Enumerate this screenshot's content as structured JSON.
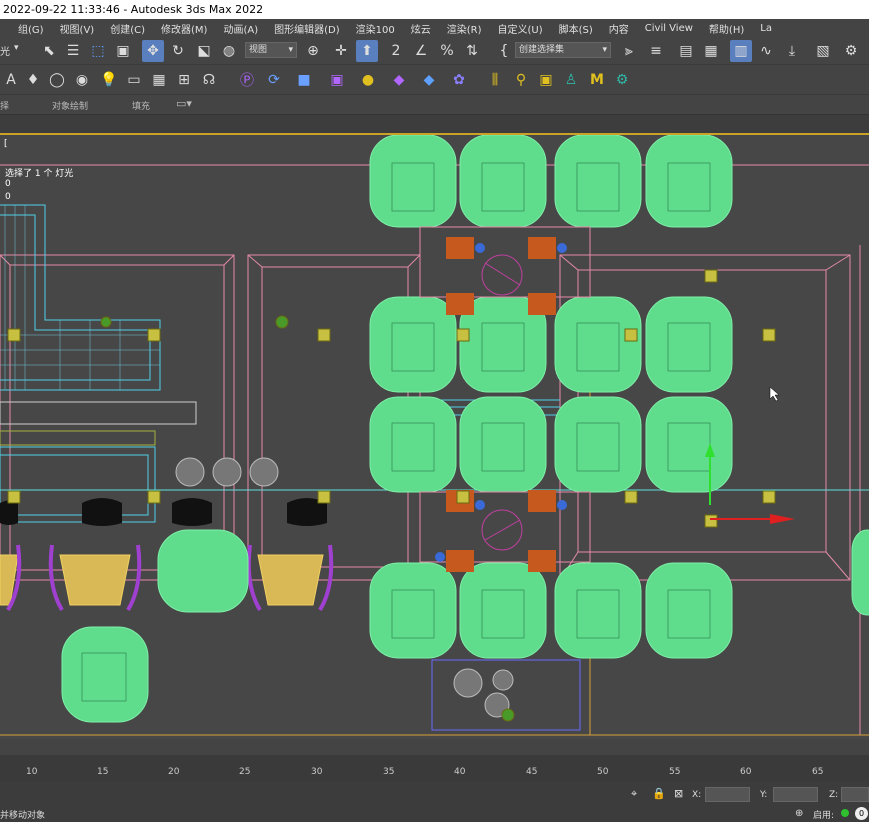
{
  "window": {
    "title": "2022-09-22 11:33:46 - Autodesk 3ds Max 2022"
  },
  "menu": [
    "组(G)",
    "视图(V)",
    "创建(C)",
    "修改器(M)",
    "动画(A)",
    "图形编辑器(D)",
    "渲染100",
    "炫云",
    "渲染(R)",
    "自定义(U)",
    "脚本(S)",
    "内容",
    "Civil View",
    "帮助(H)",
    "La"
  ],
  "toolbar": {
    "view_dropdown": "视图",
    "selection_set_dropdown": "创建选择集",
    "left_clip": "光"
  },
  "ribbon": {
    "tabs": [
      "择",
      "对象绘制",
      "填充"
    ]
  },
  "viewport": {
    "label": "[",
    "selection_info": "选择了 1 个 灯光",
    "line2": "0",
    "line3": "0"
  },
  "timeline": {
    "ticks": [
      "10",
      "15",
      "20",
      "25",
      "30",
      "35",
      "40",
      "45",
      "50",
      "55",
      "60",
      "65"
    ]
  },
  "status": {
    "prompt": "并移动对象",
    "x_label": "X:",
    "y_label": "Y:",
    "z_label": "Z:",
    "enable_label": "启用:",
    "x_value": "",
    "y_value": "",
    "z_value": ""
  }
}
